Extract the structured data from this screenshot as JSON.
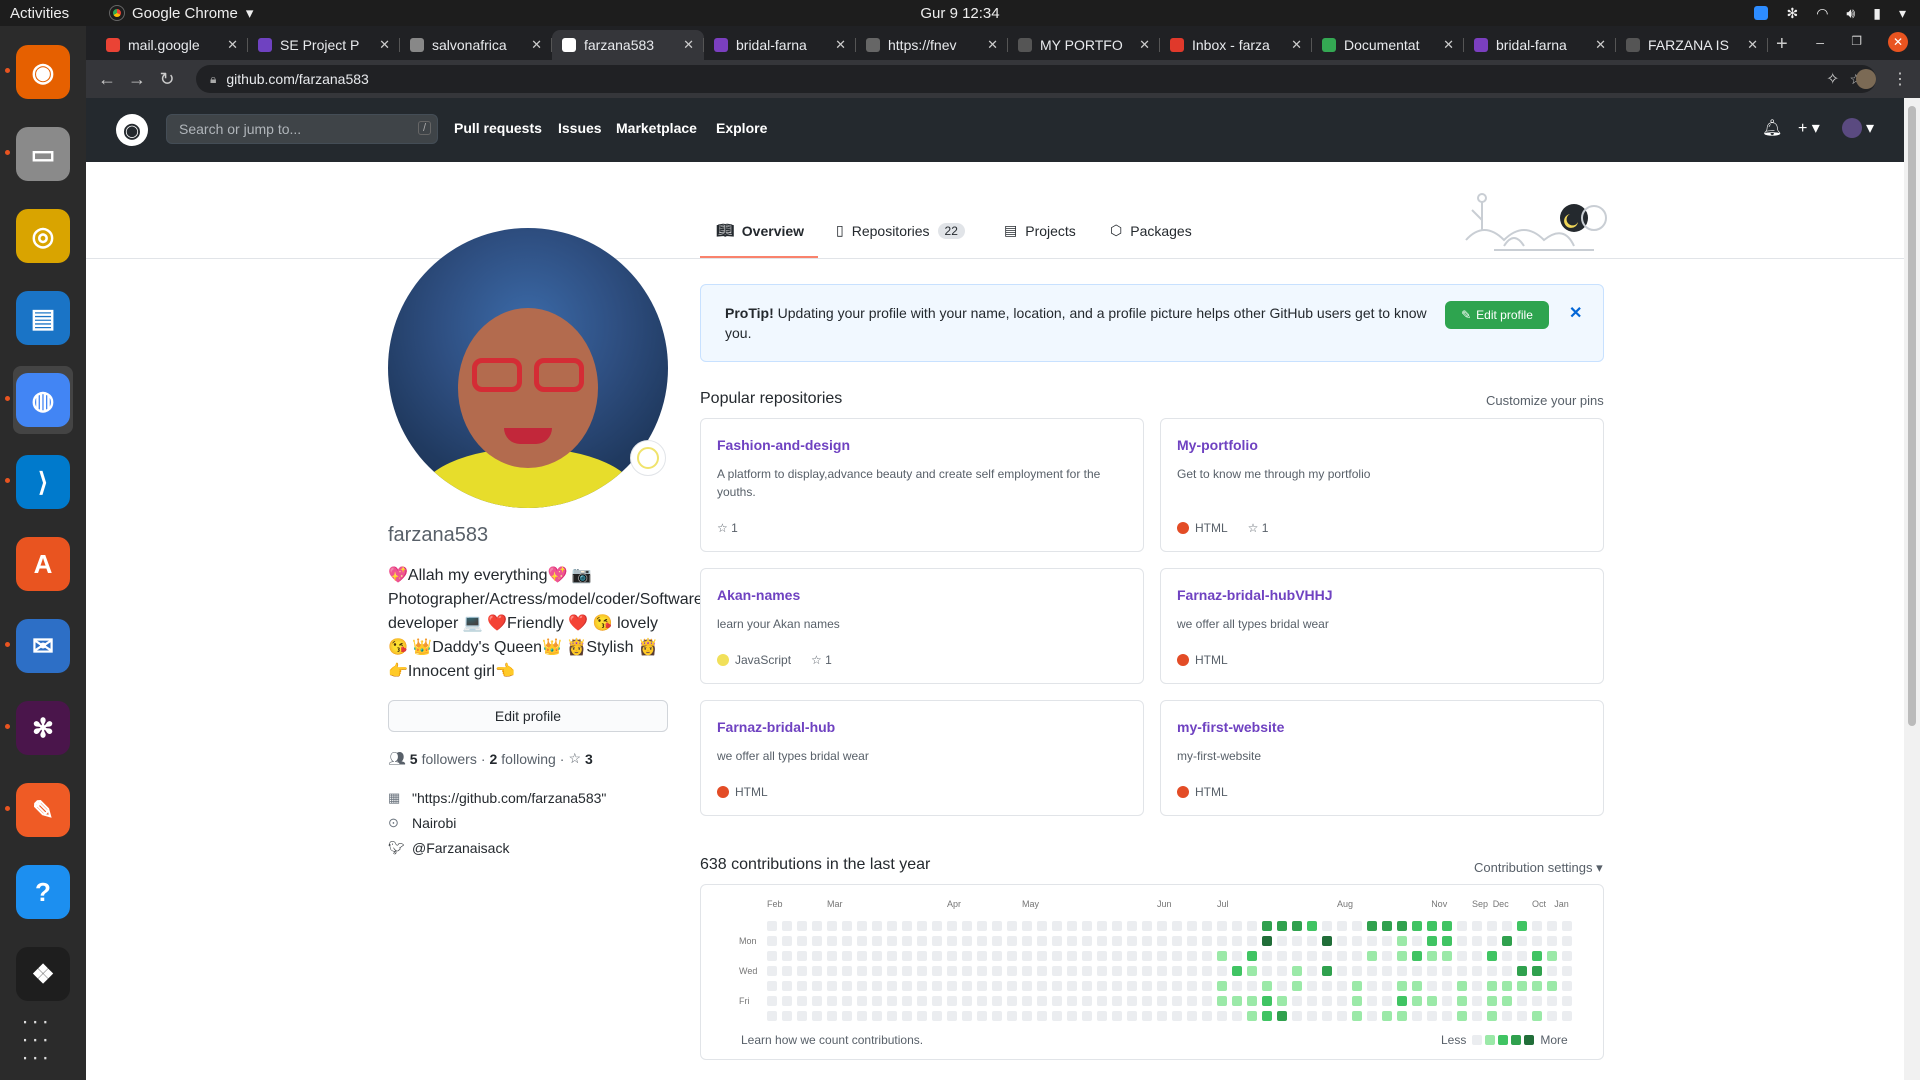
{
  "os": {
    "activities": "Activities",
    "app_name": "Google Chrome",
    "clock": "Gur 9  12:34"
  },
  "dock": {
    "items": [
      {
        "name": "firefox",
        "color": "#e66000"
      },
      {
        "name": "files",
        "color": "#8a8a8a"
      },
      {
        "name": "rhythmbox",
        "color": "#d9a400"
      },
      {
        "name": "libreoffice-writer",
        "color": "#1a74c6"
      },
      {
        "name": "chrome",
        "color": "#4285f4"
      },
      {
        "name": "vscode",
        "color": "#007acc"
      },
      {
        "name": "ubuntu-software",
        "color": "#e95420"
      },
      {
        "name": "thunderbird",
        "color": "#2d6fc6"
      },
      {
        "name": "slack",
        "color": "#4a154b"
      },
      {
        "name": "postman",
        "color": "#ef5b25"
      },
      {
        "name": "help",
        "color": "#1c8ff0"
      },
      {
        "name": "figma",
        "color": "#1e1e1e"
      }
    ]
  },
  "tabs": [
    {
      "title": "mail.google",
      "color": "#ea4335"
    },
    {
      "title": "SE Project P",
      "color": "#6f42c1"
    },
    {
      "title": "salvonafrica",
      "color": "#888"
    },
    {
      "title": "farzana583",
      "color": "#ffffff"
    },
    {
      "title": "bridal-farna",
      "color": "#7b3fbf"
    },
    {
      "title": "https://fnev",
      "color": "#666"
    },
    {
      "title": "MY PORTFO",
      "color": "#555"
    },
    {
      "title": "Inbox - farza",
      "color": "#e0392b"
    },
    {
      "title": "Documentat",
      "color": "#34a853"
    },
    {
      "title": "bridal-farna",
      "color": "#7b3fbf"
    },
    {
      "title": "FARZANA IS",
      "color": "#555"
    }
  ],
  "active_tab_index": 3,
  "url": "github.com/farzana583",
  "github": {
    "search_placeholder": "Search or jump to...",
    "search_shortcut": "/",
    "nav": [
      "Pull requests",
      "Issues",
      "Marketplace",
      "Explore"
    ],
    "profile_tabs": [
      {
        "label": "Overview",
        "icon": "book-icon"
      },
      {
        "label": "Repositories",
        "icon": "repo-icon",
        "count": "22"
      },
      {
        "label": "Projects",
        "icon": "project-icon"
      },
      {
        "label": "Packages",
        "icon": "package-icon"
      }
    ],
    "username": "farzana583",
    "bio": "💖Allah my everything💖 📷 Photographer/Actress/model/coder/Software developer 💻 ❤️Friendly ❤️ 😘 lovely😘 👑Daddy's Queen👑 👸Stylish 👸 👉Innocent girl👈",
    "edit_profile": "Edit profile",
    "followers_count": "5",
    "followers_label": "followers",
    "following_count": "2",
    "following_label": "following",
    "stars_count": "3",
    "website": "\"https://github.com/farzana583\"",
    "location": "Nairobi",
    "twitter": "@Farzanaisack",
    "protip_bold": "ProTip!",
    "protip_text": "Updating your profile with your name, location, and a profile picture helps other GitHub users get to know you.",
    "protip_button": "Edit profile",
    "popular_title": "Popular repositories",
    "customize": "Customize your pins",
    "repos": [
      {
        "name": "Fashion-and-design",
        "desc": "A platform to display,advance beauty and create self employment for the youths.",
        "lang": "",
        "lang_color": "",
        "stars": "1"
      },
      {
        "name": "My-portfolio",
        "desc": "Get to know me through my portfolio",
        "lang": "HTML",
        "lang_color": "#e34c26",
        "stars": "1"
      },
      {
        "name": "Akan-names",
        "desc": "learn your Akan names",
        "lang": "JavaScript",
        "lang_color": "#f1e05a",
        "stars": "1"
      },
      {
        "name": "Farnaz-bridal-hubVHHJ",
        "desc": "we offer all types bridal wear",
        "lang": "HTML",
        "lang_color": "#e34c26",
        "stars": ""
      },
      {
        "name": "Farnaz-bridal-hub",
        "desc": "we offer all types bridal wear",
        "lang": "HTML",
        "lang_color": "#e34c26",
        "stars": ""
      },
      {
        "name": "my-first-website",
        "desc": "my-first-website",
        "lang": "HTML",
        "lang_color": "#e34c26",
        "stars": ""
      }
    ],
    "contrib_title": "638 contributions in the last year",
    "contrib_settings": "Contribution settings ▾",
    "months": [
      "Feb",
      "Mar",
      "Apr",
      "May",
      "Jun",
      "Jul",
      "Aug",
      "Sep",
      "Oct",
      "Nov",
      "Dec",
      "Jan"
    ],
    "days": [
      "Mon",
      "Wed",
      "Fri"
    ],
    "learn": "Learn how we count contributions.",
    "less": "Less",
    "more": "More",
    "level_colors": [
      "#ebedf0",
      "#9be9a8",
      "#40c463",
      "#30a14e",
      "#216e39"
    ],
    "contrib_levels": [
      [
        0,
        0,
        0,
        0,
        0,
        0,
        0
      ],
      [
        0,
        0,
        0,
        0,
        0,
        0,
        0
      ],
      [
        0,
        0,
        0,
        0,
        0,
        0,
        0
      ],
      [
        0,
        0,
        0,
        0,
        0,
        0,
        0
      ],
      [
        0,
        0,
        0,
        0,
        0,
        0,
        0
      ],
      [
        0,
        0,
        0,
        0,
        0,
        0,
        0
      ],
      [
        0,
        0,
        0,
        0,
        0,
        0,
        0
      ],
      [
        0,
        0,
        0,
        0,
        0,
        0,
        0
      ],
      [
        0,
        0,
        0,
        0,
        0,
        0,
        0
      ],
      [
        0,
        0,
        0,
        0,
        0,
        0,
        0
      ],
      [
        0,
        0,
        0,
        0,
        0,
        0,
        0
      ],
      [
        0,
        0,
        0,
        0,
        0,
        0,
        0
      ],
      [
        0,
        0,
        0,
        0,
        0,
        0,
        0
      ],
      [
        0,
        0,
        0,
        0,
        0,
        0,
        0
      ],
      [
        0,
        0,
        0,
        0,
        0,
        0,
        0
      ],
      [
        0,
        0,
        0,
        0,
        0,
        0,
        0
      ],
      [
        0,
        0,
        0,
        0,
        0,
        0,
        0
      ],
      [
        0,
        0,
        0,
        0,
        0,
        0,
        0
      ],
      [
        0,
        0,
        0,
        0,
        0,
        0,
        0
      ],
      [
        0,
        0,
        0,
        0,
        0,
        0,
        0
      ],
      [
        0,
        0,
        0,
        0,
        0,
        0,
        0
      ],
      [
        0,
        0,
        0,
        0,
        0,
        0,
        0
      ],
      [
        0,
        0,
        0,
        0,
        0,
        0,
        0
      ],
      [
        0,
        0,
        0,
        0,
        0,
        0,
        0
      ],
      [
        0,
        0,
        0,
        0,
        0,
        0,
        0
      ],
      [
        0,
        0,
        0,
        0,
        0,
        0,
        0
      ],
      [
        0,
        0,
        0,
        0,
        0,
        0,
        0
      ],
      [
        0,
        0,
        0,
        0,
        0,
        0,
        0
      ],
      [
        0,
        0,
        0,
        0,
        0,
        0,
        0
      ],
      [
        0,
        0,
        0,
        0,
        0,
        0,
        0
      ],
      [
        0,
        0,
        1,
        0,
        1,
        1,
        0
      ],
      [
        0,
        0,
        0,
        2,
        0,
        1,
        0
      ],
      [
        0,
        0,
        2,
        1,
        0,
        1,
        1
      ],
      [
        3,
        4,
        0,
        0,
        1,
        2,
        2
      ],
      [
        3,
        0,
        0,
        0,
        0,
        1,
        3
      ],
      [
        3,
        0,
        0,
        1,
        1,
        0,
        0
      ],
      [
        2,
        0,
        0,
        0,
        0,
        0,
        0
      ],
      [
        0,
        4,
        0,
        3,
        0,
        0,
        0
      ],
      [
        0,
        0,
        0,
        0,
        0,
        0,
        0
      ],
      [
        0,
        0,
        0,
        0,
        1,
        1,
        1
      ],
      [
        3,
        0,
        1,
        0,
        0,
        0,
        0
      ],
      [
        3,
        0,
        0,
        0,
        0,
        0,
        1
      ],
      [
        3,
        1,
        1,
        0,
        1,
        2,
        1
      ],
      [
        2,
        0,
        2,
        0,
        1,
        1,
        0
      ],
      [
        2,
        2,
        1,
        0,
        0,
        1,
        0
      ],
      [
        2,
        2,
        1,
        0,
        0,
        0,
        0
      ],
      [
        0,
        0,
        0,
        0,
        1,
        1,
        1
      ],
      [
        0,
        0,
        0,
        0,
        0,
        0,
        0
      ],
      [
        0,
        0,
        2,
        0,
        1,
        1,
        1
      ],
      [
        0,
        3,
        0,
        0,
        1,
        1,
        0
      ],
      [
        2,
        0,
        0,
        3,
        1,
        0,
        0
      ],
      [
        0,
        0,
        2,
        3,
        1,
        0,
        1
      ],
      [
        0,
        0,
        1,
        0,
        1,
        0,
        0
      ],
      [
        0,
        0,
        0,
        0,
        0,
        0,
        0
      ]
    ]
  }
}
